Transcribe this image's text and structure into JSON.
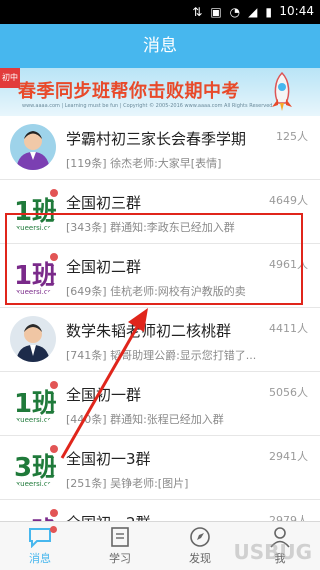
{
  "status": {
    "time": "10:44"
  },
  "nav": {
    "title": "消息"
  },
  "banner": {
    "tag": "初中",
    "headline": "春季同步班帮你击败期中考",
    "footnote": "www.aaaa.com | Learning must be fun | Copyright © 2005-2016 www.aaaa.com All Rights Reserved"
  },
  "groups": [
    {
      "title": "学霸村初三家长会春季学期",
      "count": "125人",
      "subtitle": "[119条] 徐杰老师:大家早[表情]",
      "avatar": "person-photo-icon"
    },
    {
      "title": "全国初三群",
      "count": "4649人",
      "subtitle": "[343条] 群通知:李政东已经加入群",
      "avatar": "1ban-green-icon"
    },
    {
      "title": "全国初二群",
      "count": "4961人",
      "subtitle": "[649条] 佳杭老师:网校有沪教版的卖",
      "avatar": "1ban-purple-icon"
    },
    {
      "title": "数学朱韬老师初二核桃群",
      "count": "4411人",
      "subtitle": "[741条] 韬哥助理公爵:显示您打错了...",
      "avatar": "teacher-photo-icon"
    },
    {
      "title": "全国初一群",
      "count": "5056人",
      "subtitle": "[440条] 群通知:张程已经加入群",
      "avatar": "1ban-green-icon"
    },
    {
      "title": "全国初一3群",
      "count": "2941人",
      "subtitle": "[251条] 吴铮老师:[图片]",
      "avatar": "3ban-green-icon"
    },
    {
      "title": "全国初一2群",
      "count": "2979人",
      "subtitle": "",
      "avatar": "1ban-purple-icon"
    }
  ],
  "tabs": [
    {
      "label": "消息",
      "icon": "chat-icon"
    },
    {
      "label": "学习",
      "icon": "book-icon"
    },
    {
      "label": "发现",
      "icon": "compass-icon"
    },
    {
      "label": "我",
      "icon": "user-icon"
    }
  ],
  "watermark": "USBUG"
}
